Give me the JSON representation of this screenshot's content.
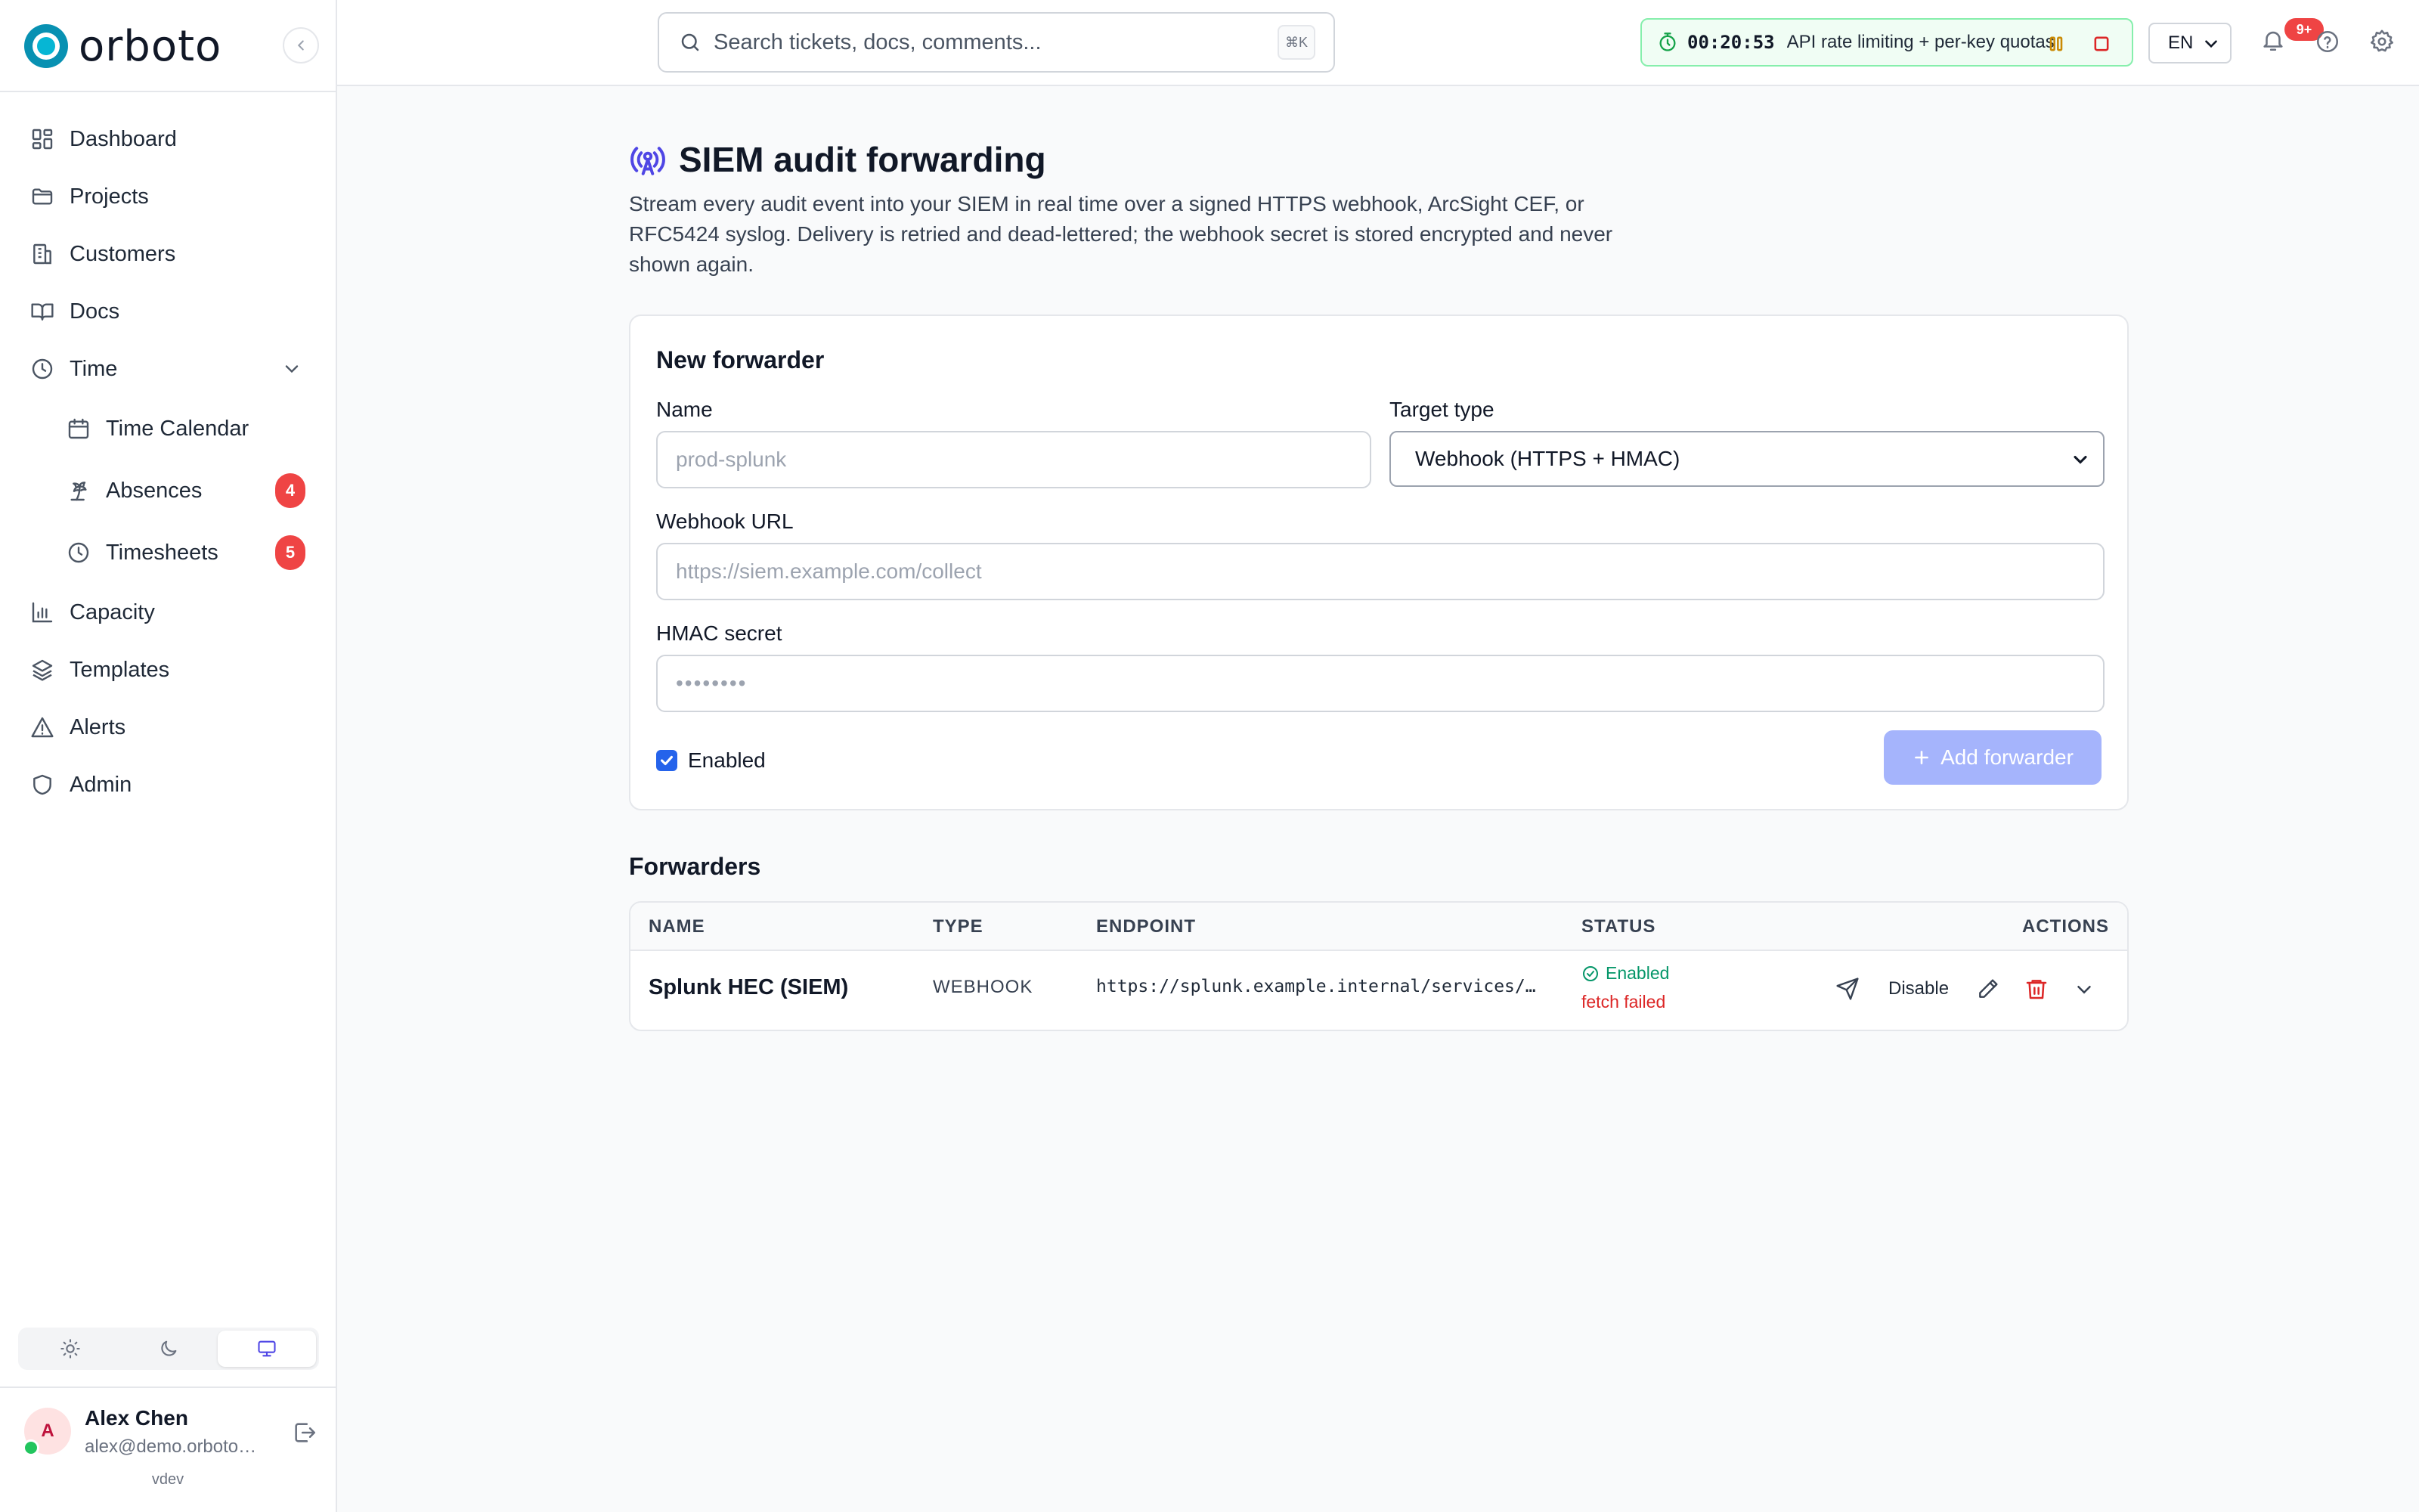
{
  "app": {
    "brand": "orboto",
    "version": "vdev"
  },
  "sidebar": {
    "items": [
      {
        "label": "Dashboard",
        "icon": "dashboard-icon"
      },
      {
        "label": "Projects",
        "icon": "folder-icon"
      },
      {
        "label": "Customers",
        "icon": "building-icon"
      },
      {
        "label": "Docs",
        "icon": "book-icon"
      },
      {
        "label": "Time",
        "icon": "clock-icon",
        "expanded": true
      },
      {
        "label": "Time Calendar",
        "icon": "calendar-icon",
        "sub": true
      },
      {
        "label": "Absences",
        "icon": "palm-tree-icon",
        "sub": true,
        "badge": "4"
      },
      {
        "label": "Timesheets",
        "icon": "clock-icon",
        "sub": true,
        "badge": "5"
      },
      {
        "label": "Capacity",
        "icon": "bar-chart-icon"
      },
      {
        "label": "Templates",
        "icon": "layers-icon"
      },
      {
        "label": "Alerts",
        "icon": "alert-triangle-icon"
      },
      {
        "label": "Admin",
        "icon": "shield-icon"
      }
    ],
    "theme_options": [
      "light",
      "dark",
      "system"
    ],
    "theme_selected": "system"
  },
  "user": {
    "initial": "A",
    "name": "Alex Chen",
    "email": "alex@demo.orboto.com"
  },
  "topbar": {
    "search_placeholder": "Search tickets, docs, comments...",
    "search_shortcut": "⌘K",
    "timer_time": "00:20:53",
    "timer_task": "API rate limiting + per-key quotas",
    "language": "EN",
    "notifications_badge": "9+"
  },
  "page": {
    "title": "SIEM audit forwarding",
    "description": "Stream every audit event into your SIEM in real time over a signed HTTPS webhook, ArcSight CEF, or RFC5424 syslog. Delivery is retried and dead-lettered; the webhook secret is stored encrypted and never shown again."
  },
  "form": {
    "title": "New forwarder",
    "name_label": "Name",
    "name_placeholder": "prod-splunk",
    "target_label": "Target type",
    "target_value": "Webhook (HTTPS + HMAC)",
    "url_label": "Webhook URL",
    "url_placeholder": "https://siem.example.com/collect",
    "secret_label": "HMAC secret",
    "secret_placeholder": "••••••••",
    "enabled_label": "Enabled",
    "enabled": true,
    "add_label": "Add forwarder"
  },
  "forwarders": {
    "title": "Forwarders",
    "columns": [
      "NAME",
      "TYPE",
      "ENDPOINT",
      "STATUS",
      "ACTIONS"
    ],
    "rows": [
      {
        "name": "Splunk HEC (SIEM)",
        "type": "WEBHOOK",
        "endpoint": "https://splunk.example.internal/services/collector/event",
        "status": "Enabled",
        "error": "fetch failed",
        "disable_label": "Disable"
      }
    ]
  },
  "colors": {
    "brand": "#0891b2",
    "accent": "#4f46e5",
    "button_disabled": "#a5b4fc",
    "success": "#059669",
    "danger": "#dc2626",
    "badge": "#ef4444"
  }
}
